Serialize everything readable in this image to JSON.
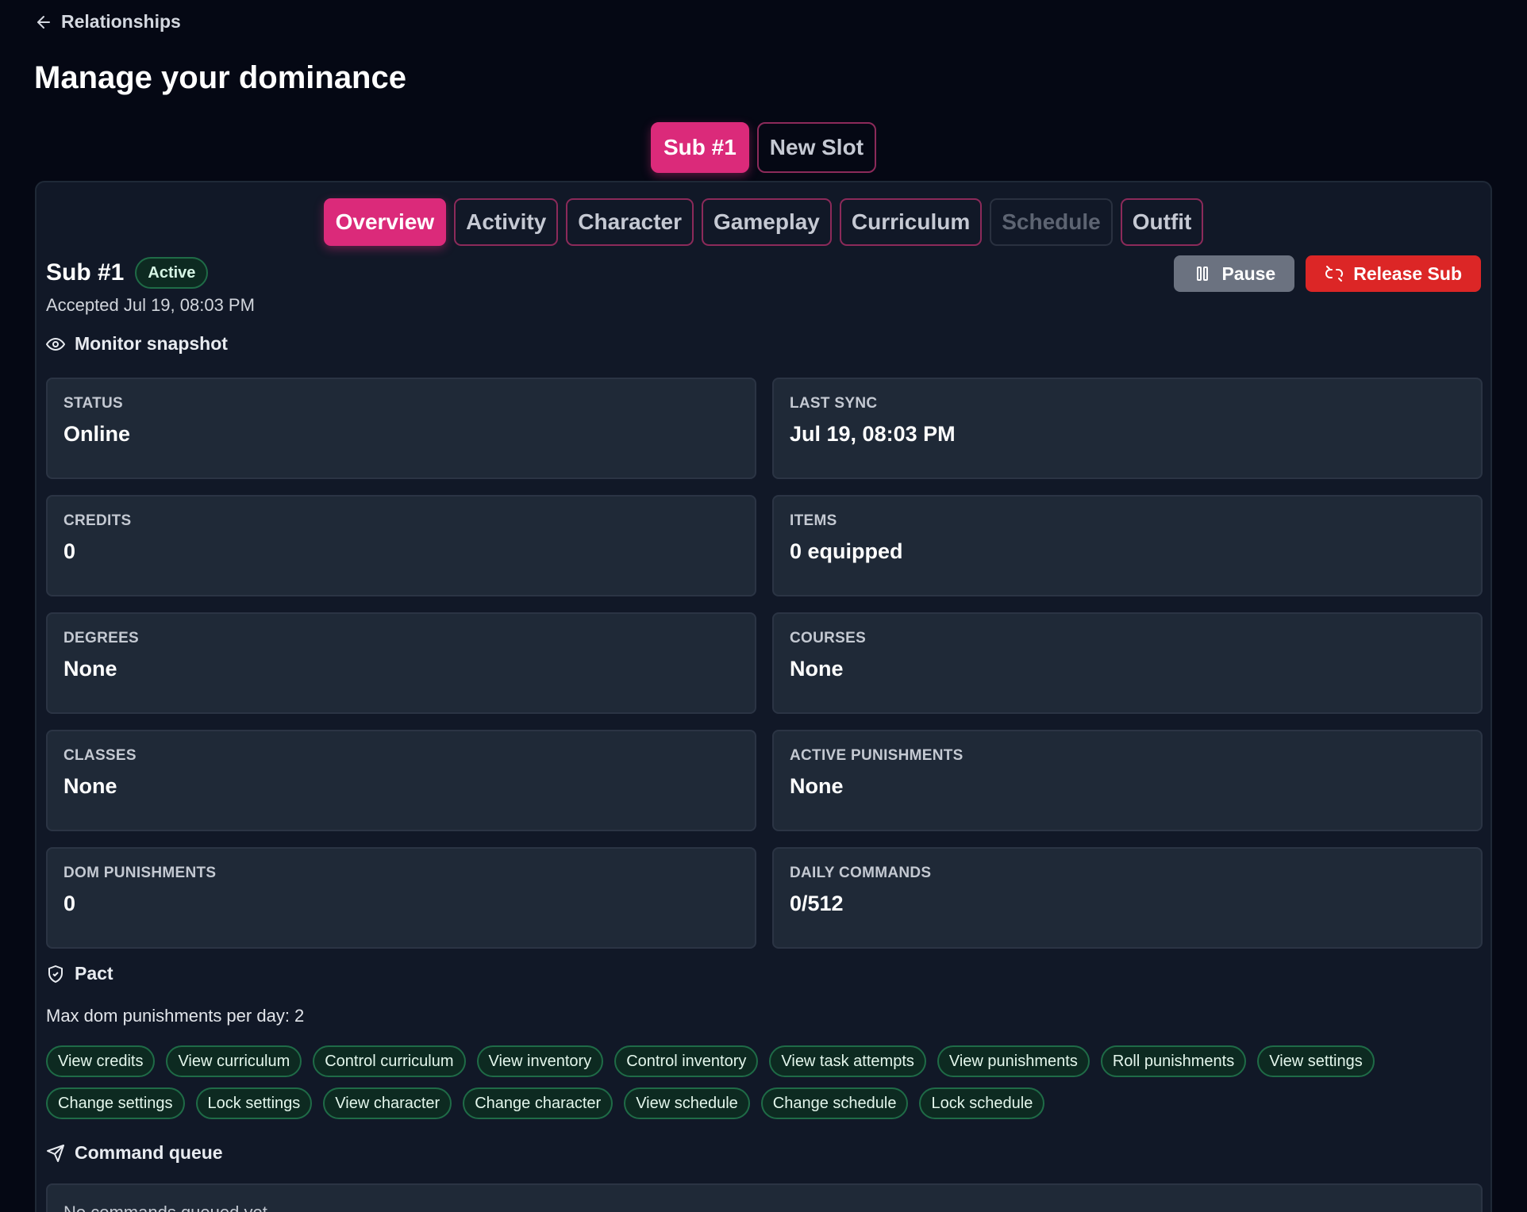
{
  "nav": {
    "back_label": "Relationships"
  },
  "title": "Manage your dominance",
  "slot_tabs": [
    {
      "label": "Sub #1",
      "active": true
    },
    {
      "label": "New Slot",
      "active": false
    }
  ],
  "sub_tabs": [
    {
      "label": "Overview",
      "state": "active"
    },
    {
      "label": "Activity",
      "state": "normal"
    },
    {
      "label": "Character",
      "state": "normal"
    },
    {
      "label": "Gameplay",
      "state": "normal"
    },
    {
      "label": "Curriculum",
      "state": "normal"
    },
    {
      "label": "Schedule",
      "state": "disabled"
    },
    {
      "label": "Outfit",
      "state": "normal"
    }
  ],
  "sub": {
    "name": "Sub #1",
    "status_badge": "Active",
    "accepted": "Accepted Jul 19, 08:03 PM"
  },
  "actions": {
    "pause": "Pause",
    "release": "Release Sub"
  },
  "monitor": {
    "heading": "Monitor snapshot",
    "stats": [
      {
        "label": "STATUS",
        "value": "Online"
      },
      {
        "label": "LAST SYNC",
        "value": "Jul 19, 08:03 PM"
      },
      {
        "label": "CREDITS",
        "value": "0"
      },
      {
        "label": "ITEMS",
        "value": "0 equipped"
      },
      {
        "label": "DEGREES",
        "value": "None"
      },
      {
        "label": "COURSES",
        "value": "None"
      },
      {
        "label": "CLASSES",
        "value": "None"
      },
      {
        "label": "ACTIVE PUNISHMENTS",
        "value": "None"
      },
      {
        "label": "DOM PUNISHMENTS",
        "value": "0"
      },
      {
        "label": "DAILY COMMANDS",
        "value": "0/512"
      }
    ]
  },
  "pact": {
    "heading": "Pact",
    "max_text": "Max dom punishments per day: 2",
    "permissions": [
      "View credits",
      "View curriculum",
      "Control curriculum",
      "View inventory",
      "Control inventory",
      "View task attempts",
      "View punishments",
      "Roll punishments",
      "View settings",
      "Change settings",
      "Lock settings",
      "View character",
      "Change character",
      "View schedule",
      "Change schedule",
      "Lock schedule"
    ]
  },
  "queue": {
    "heading": "Command queue",
    "empty_text": "No commands queued yet."
  },
  "colors": {
    "accent": "#db2a7a",
    "danger": "#dc2626",
    "success_border": "#1f6b47",
    "background": "#050814",
    "panel": "#111827",
    "card": "#1f2937"
  }
}
